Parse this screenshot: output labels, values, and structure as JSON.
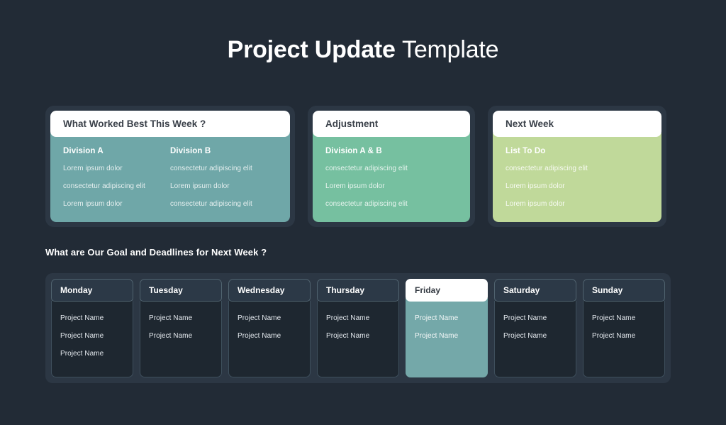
{
  "title": {
    "bold": "Project Update",
    "light": "Template"
  },
  "colors": {
    "background": "#222b36",
    "card_frame": "#2c3744",
    "card_teal": "#6fa7a8",
    "card_green": "#76c0a0",
    "card_lime": "#c0d99a",
    "day_body": "#1e2730",
    "day_header": "#2c3947",
    "highlight_teal": "#74a8a9",
    "white": "#ffffff",
    "header_text": "#3a4049"
  },
  "cards": [
    {
      "header": "What Worked Best This Week ?",
      "columns": [
        {
          "heading": "Division A",
          "items": [
            "Lorem ipsum dolor",
            "consectetur adipiscing elit",
            "Lorem ipsum dolor"
          ]
        },
        {
          "heading": "Division B",
          "items": [
            "consectetur adipiscing elit",
            "Lorem ipsum dolor",
            "consectetur adipiscing elit"
          ]
        }
      ]
    },
    {
      "header": "Adjustment",
      "columns": [
        {
          "heading": "Division A & B",
          "items": [
            "consectetur adipiscing elit",
            "Lorem ipsum dolor",
            "consectetur adipiscing elit"
          ]
        }
      ]
    },
    {
      "header": "Next Week",
      "columns": [
        {
          "heading": "List To Do",
          "items": [
            "consectetur adipiscing elit",
            "Lorem ipsum dolor",
            "Lorem ipsum dolor"
          ]
        }
      ]
    }
  ],
  "section": {
    "heading": "What are Our Goal and Deadlines for Next Week ?"
  },
  "days": [
    {
      "label": "Monday",
      "highlighted": false,
      "items": [
        "Project Name",
        "Project Name",
        "Project Name"
      ]
    },
    {
      "label": "Tuesday",
      "highlighted": false,
      "items": [
        "Project Name",
        "Project Name"
      ]
    },
    {
      "label": "Wednesday",
      "highlighted": false,
      "items": [
        "Project Name",
        "Project Name"
      ]
    },
    {
      "label": "Thursday",
      "highlighted": false,
      "items": [
        "Project Name",
        "Project Name"
      ]
    },
    {
      "label": "Friday",
      "highlighted": true,
      "items": [
        "Project Name",
        "Project Name"
      ]
    },
    {
      "label": "Saturday",
      "highlighted": false,
      "items": [
        "Project Name",
        "Project Name"
      ]
    },
    {
      "label": "Sunday",
      "highlighted": false,
      "items": [
        "Project Name",
        "Project Name"
      ]
    }
  ]
}
